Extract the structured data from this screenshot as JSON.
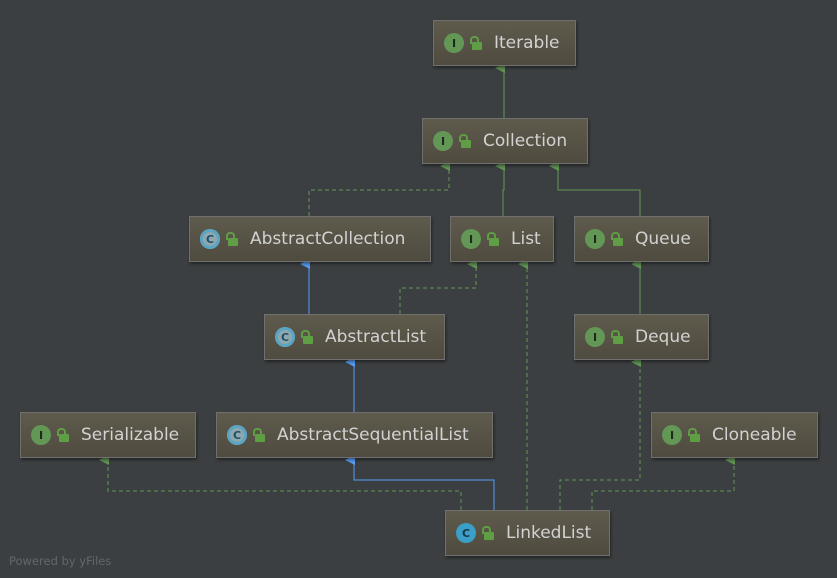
{
  "nodes": {
    "iterable": {
      "label": "Iterable",
      "kind": "interface"
    },
    "collection": {
      "label": "Collection",
      "kind": "interface"
    },
    "abstract_collection": {
      "label": "AbstractCollection",
      "kind": "abstract-class"
    },
    "list": {
      "label": "List",
      "kind": "interface"
    },
    "queue": {
      "label": "Queue",
      "kind": "interface"
    },
    "abstract_list": {
      "label": "AbstractList",
      "kind": "abstract-class"
    },
    "deque": {
      "label": "Deque",
      "kind": "interface"
    },
    "serializable": {
      "label": "Serializable",
      "kind": "interface"
    },
    "abstract_sequential_list": {
      "label": "AbstractSequentialList",
      "kind": "abstract-class"
    },
    "cloneable": {
      "label": "Cloneable",
      "kind": "interface"
    },
    "linked_list": {
      "label": "LinkedList",
      "kind": "class"
    }
  },
  "badges": {
    "interface": "I",
    "class": "C"
  },
  "edges": [
    {
      "from": "Collection",
      "to": "Iterable",
      "type": "extends"
    },
    {
      "from": "AbstractCollection",
      "to": "Collection",
      "type": "implements"
    },
    {
      "from": "List",
      "to": "Collection",
      "type": "extends"
    },
    {
      "from": "Queue",
      "to": "Collection",
      "type": "extends"
    },
    {
      "from": "AbstractList",
      "to": "AbstractCollection",
      "type": "extends-class"
    },
    {
      "from": "AbstractList",
      "to": "List",
      "type": "implements"
    },
    {
      "from": "Deque",
      "to": "Queue",
      "type": "extends"
    },
    {
      "from": "AbstractSequentialList",
      "to": "AbstractList",
      "type": "extends-class"
    },
    {
      "from": "LinkedList",
      "to": "Serializable",
      "type": "implements"
    },
    {
      "from": "LinkedList",
      "to": "AbstractSequentialList",
      "type": "extends-class"
    },
    {
      "from": "LinkedList",
      "to": "List",
      "type": "implements"
    },
    {
      "from": "LinkedList",
      "to": "Deque",
      "type": "implements"
    },
    {
      "from": "LinkedList",
      "to": "Cloneable",
      "type": "implements"
    }
  ],
  "colors": {
    "background": "#3c3f41",
    "interface_edge": "#629755",
    "class_edge": "#589df6",
    "node_fill": "#575345"
  },
  "footer": "Powered by yFiles"
}
